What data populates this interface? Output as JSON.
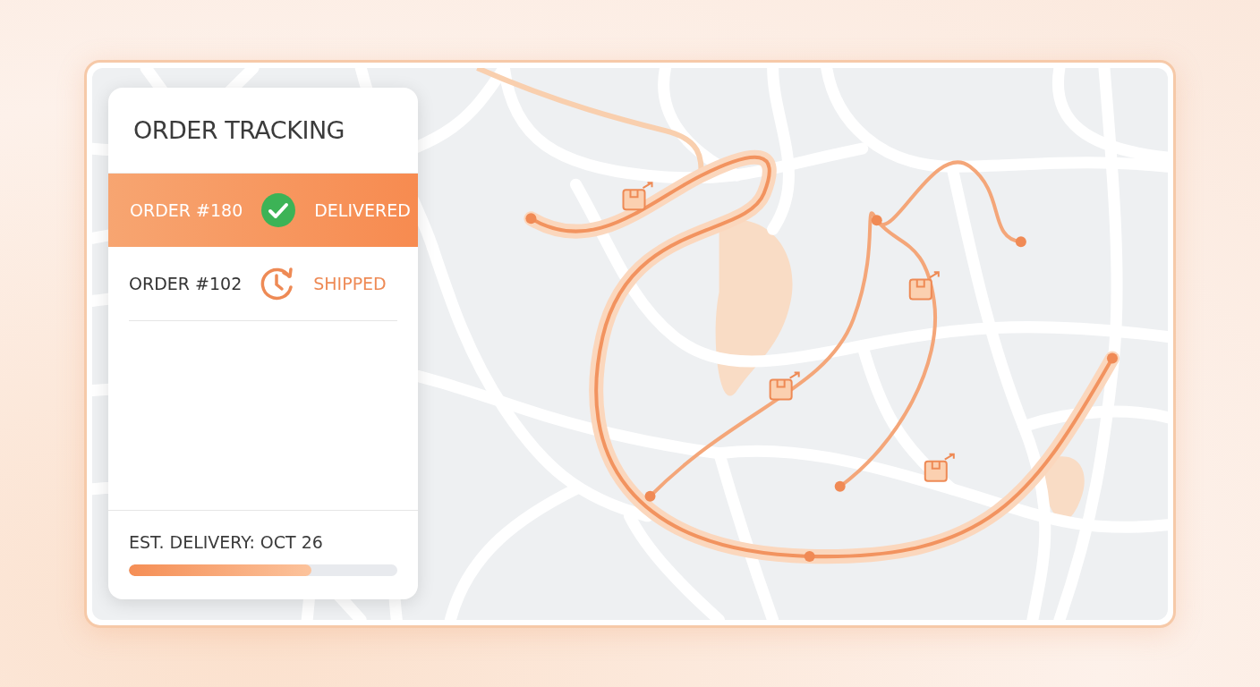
{
  "panel": {
    "title": "ORDER TRACKING"
  },
  "orders": [
    {
      "label": "ORDER #180",
      "status": "DELIVERED",
      "kind": "delivered",
      "selected": true
    },
    {
      "label": "ORDER #102",
      "status": "SHIPPED",
      "kind": "shipped",
      "selected": false
    }
  ],
  "delivery": {
    "label": "EST. DELIVERY: OCT 26",
    "level": 0.68
  }
}
